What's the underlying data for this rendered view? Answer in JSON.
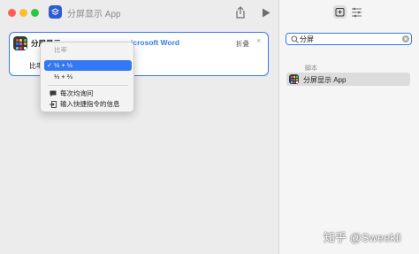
{
  "window": {
    "title": "分屏显示 App"
  },
  "action_card": {
    "title": "分屏显示",
    "param": "icrosoft Word",
    "fold_label": "折叠",
    "close_glyph": "×",
    "ratio_label": "比率"
  },
  "ratio_menu": {
    "header": "比率",
    "options": [
      {
        "check": "✓",
        "label": "½ + ½",
        "selected": true
      },
      {
        "check": "",
        "label": "⅓ + ⅔",
        "selected": false
      }
    ],
    "extra_items": [
      {
        "icon": "speech-bubble-icon",
        "label": "每次均询问"
      },
      {
        "icon": "input-icon",
        "label": "输入快捷指令的信息"
      }
    ]
  },
  "sidebar": {
    "search": {
      "value": "分屏",
      "placeholder": ""
    },
    "section_label": "脚本",
    "results": [
      {
        "label": "分屏显示 App"
      }
    ]
  },
  "watermark": "知乎 @Sweekli",
  "colors": {
    "accent": "#3478f6",
    "window_bg": "#ececec",
    "sidebar_bg": "#f5f5f5",
    "app_icon": "#2f5bd3"
  }
}
